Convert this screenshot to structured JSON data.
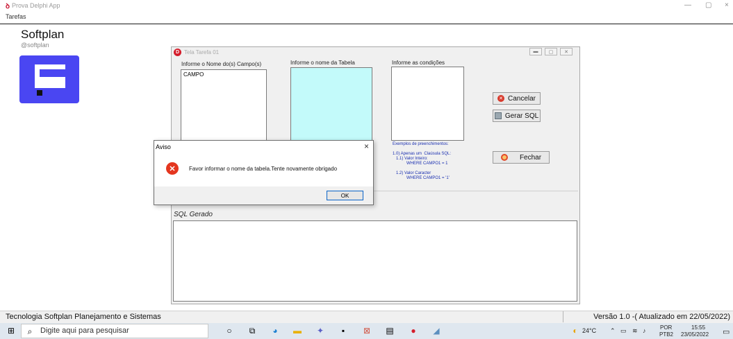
{
  "app": {
    "title": "Prova Delphi App",
    "menu": "Tarefas",
    "brand_title": "Softplan",
    "brand_handle": "@softplan",
    "window_controls": [
      "—",
      "▢",
      "×"
    ]
  },
  "form": {
    "title": "Tela Tarefa 01",
    "label_campos": "Informe o Nome do(s) Campo(s)",
    "campos_value": "CAMPO",
    "label_tabela": "Informe o nome da Tabela",
    "label_condicoes": "Informe as condições",
    "btn_cancelar": "Cancelar",
    "btn_gerar": "Gerar SQL",
    "btn_fechar": "Fechar",
    "examples": "Exemplos de preenchimentos:\n\n1.0) Apenas um  Claúsula SQL:\n   1.1) Valor Inteiro:\n            WHERE CAMPO1 = 1\n\n   1.2) Valor Caracter\n            WHERE CAMPO1 = '1'",
    "sql_label": "SQL Gerado",
    "accent_color": "#c3fafa"
  },
  "dialog": {
    "title": "Aviso",
    "message": "Favor informar o nome da tabela.Tente novamente obrigado",
    "ok": "OK",
    "close": "×"
  },
  "status": {
    "left": "Tecnologia Softplan Planejamento e Sistemas",
    "right": "Versão 1.0 -( Atualizado em 22/05/2022)"
  },
  "taskbar": {
    "search_placeholder": "Digite aqui para pesquisar",
    "temperature": "24°C",
    "lang_top": "POR",
    "lang_bottom": "PTB2",
    "time": "15:55",
    "date": "23/05/2022"
  }
}
